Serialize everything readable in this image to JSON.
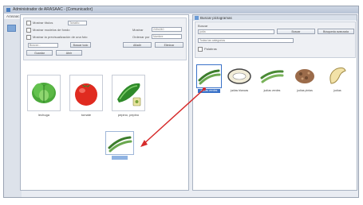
{
  "window": {
    "title": "Administrador de ARASAAC - [Comunicador]",
    "menu": [
      "Arasaac",
      "Edición",
      "Ayuda"
    ]
  },
  "left_dialog": {
    "options": {
      "check1_label": "Mostrar títulos",
      "check1_value": "Tamaño",
      "check2_label": "Mostrar modelos de fondo",
      "check3_label": "Mostrar la previsualización de una foto",
      "quality_label": "Mostrar",
      "quality_value": "240x240",
      "order_label": "Ordenar por",
      "order_value": "Nombre"
    },
    "buttons": {
      "search_placeholder": "Buscar...",
      "search_button": "Buscar todo",
      "add_button": "Añadir",
      "delete_button": "Eliminar",
      "save_button": "Guardar",
      "open_button": "Abrir"
    },
    "tiles": [
      {
        "label": "lechuga",
        "icon": "lettuce-icon"
      },
      {
        "label": "tomate",
        "icon": "tomato-icon"
      },
      {
        "label": "pepino, pepino",
        "icon": "cucumber-icon"
      }
    ],
    "ghost_label": "judías verdes"
  },
  "right_dialog": {
    "title": "Buscar pictogramas",
    "search_label": "Buscar",
    "search_value": "judía",
    "search_button": "Buscar",
    "advanced_button": "Búsqueda avanzada",
    "category_value": "Todas las categorías",
    "filter_label": "Palabras",
    "tiles": [
      {
        "label": "judías verdes",
        "icon": "green-beans-icon",
        "selected": true
      },
      {
        "label": "judías blancas",
        "icon": "white-beans-icon"
      },
      {
        "label": "judías verdes",
        "icon": "green-beans-2-icon"
      },
      {
        "label": "judías pintas",
        "icon": "pinto-beans-icon"
      },
      {
        "label": "judías",
        "icon": "bean-icon"
      }
    ]
  },
  "colors": {
    "accent": "#3a72c8",
    "arrow": "#d62b2b"
  }
}
